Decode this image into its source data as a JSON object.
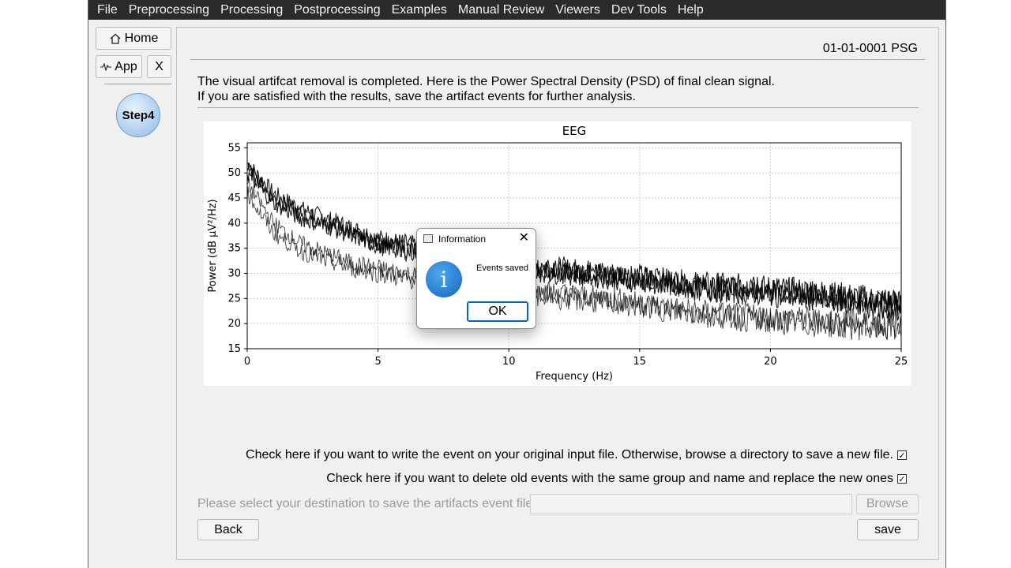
{
  "menu": [
    "File",
    "Preprocessing",
    "Processing",
    "Postprocessing",
    "Examples",
    "Manual Review",
    "Viewers",
    "Dev Tools",
    "Help"
  ],
  "sidebar": {
    "home_label": "Home",
    "app_label": "App",
    "close_label": "X",
    "step_label": "Step4"
  },
  "header": {
    "psg_id": "01-01-0001 PSG"
  },
  "description": {
    "line1": "The visual artifcat removal is completed. Here is the Power Spectral Density (PSD) of final clean signal.",
    "line2": "If you are satisfied with the results, save the artifact events for further analysis."
  },
  "options": {
    "write_original_label": "Check here if you want to write the event on your original input file. Otherwise, browse a directory to save a new file.",
    "write_original_checked": true,
    "replace_events_label": "Check here if you want to delete old events with the same group and name and replace the new ones",
    "replace_events_checked": true,
    "check_mark": "✓",
    "destination_label": "Please select your destination to save the artifacts event file:",
    "destination_value": "",
    "browse_label": "Browse"
  },
  "footer": {
    "back_label": "Back",
    "save_label": "save"
  },
  "dialog": {
    "title": "Information",
    "message": "Events saved",
    "ok_label": "OK",
    "close_glyph": "✕",
    "icon_glyph": "i"
  },
  "chart_data": {
    "type": "line",
    "title": "EEG",
    "xlabel": "Frequency (Hz)",
    "ylabel": "Power (dB µV²/Hz)",
    "xlim": [
      0,
      25
    ],
    "ylim": [
      15,
      56
    ],
    "xticks": [
      0,
      5,
      10,
      15,
      20,
      25
    ],
    "yticks": [
      15,
      20,
      25,
      30,
      35,
      40,
      45,
      50,
      55
    ],
    "grid": true,
    "line_color": "#000000",
    "series": [
      {
        "x": [
          0,
          0.5,
          1,
          2,
          3,
          4,
          5,
          6,
          7,
          8,
          9,
          10,
          12,
          14,
          15,
          17,
          20,
          22,
          25
        ],
        "values": [
          52,
          49,
          46,
          43,
          41,
          39,
          37,
          36,
          35,
          34,
          33,
          32,
          31,
          30,
          29.5,
          28,
          27,
          26,
          24
        ]
      },
      {
        "x": [
          0,
          0.5,
          1,
          2,
          3,
          4,
          5,
          6,
          7,
          8,
          9,
          10,
          12,
          14,
          15,
          17,
          20,
          22,
          25
        ],
        "values": [
          51,
          48,
          45,
          42,
          40,
          38,
          36,
          35,
          34,
          33,
          32,
          31.5,
          30.5,
          29.5,
          29,
          27.5,
          26.5,
          25.5,
          23.5
        ]
      },
      {
        "x": [
          0,
          0.5,
          1,
          2,
          3,
          4,
          5,
          6,
          7,
          8,
          9,
          10,
          12,
          14,
          15,
          17,
          20,
          22,
          25
        ],
        "values": [
          50,
          47,
          44,
          41,
          39.5,
          37.5,
          35.5,
          34.5,
          33.5,
          32.5,
          31.5,
          31,
          30,
          29,
          28.5,
          27,
          26,
          25,
          23
        ]
      },
      {
        "x": [
          0,
          0.5,
          1,
          2,
          3,
          4,
          5,
          6,
          7,
          8,
          9,
          10,
          12,
          14,
          15,
          17,
          20,
          22,
          25
        ],
        "values": [
          48,
          44,
          40,
          36,
          34,
          32,
          31,
          30,
          29,
          28.5,
          28,
          27.5,
          26,
          25,
          24,
          22.5,
          21,
          20.5,
          19.5
        ]
      },
      {
        "x": [
          0,
          0.5,
          1,
          2,
          3,
          4,
          5,
          6,
          7,
          8,
          9,
          10,
          12,
          14,
          15,
          17,
          20,
          22,
          25
        ],
        "values": [
          46,
          42,
          38,
          34.5,
          32.5,
          31,
          30,
          29,
          28,
          27.5,
          27,
          26.5,
          25,
          24,
          23.5,
          22,
          20.5,
          20,
          19
        ]
      }
    ]
  }
}
